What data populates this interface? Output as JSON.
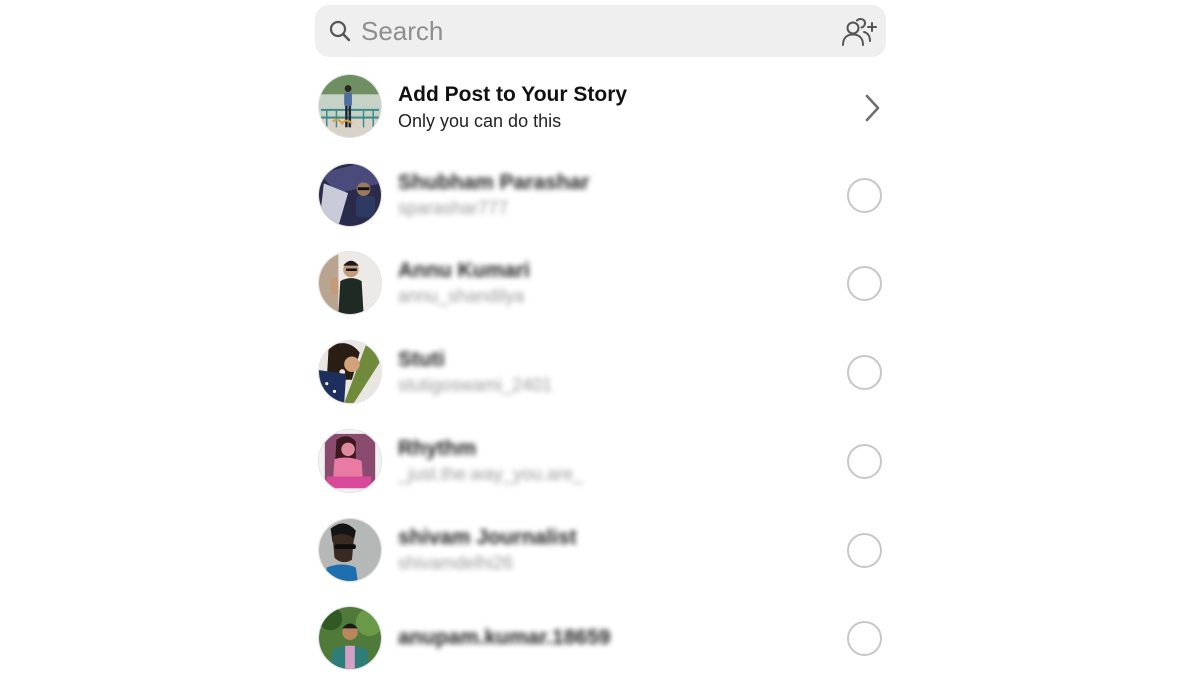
{
  "search": {
    "placeholder": "Search",
    "value": "",
    "search_icon": "magnifier-icon",
    "add_people_icon": "add-people-icon"
  },
  "story_row": {
    "title": "Add Post to Your Story",
    "subtitle": "Only you can do this",
    "trailing_icon": "chevron-right-icon"
  },
  "contacts": [
    {
      "name": "Shubham Parashar",
      "username": "sparashar777",
      "selected": false,
      "blurred": true
    },
    {
      "name": "Annu Kumari",
      "username": "annu_shandilya",
      "selected": false,
      "blurred": true
    },
    {
      "name": "Stuti",
      "username": "stutigoswami_2401",
      "selected": false,
      "blurred": true
    },
    {
      "name": "Rhythm",
      "username": "_just.the.way_you.are_",
      "selected": false,
      "blurred": true
    },
    {
      "name": "shivam Journalist",
      "username": "shivamdelhi26",
      "selected": false,
      "blurred": true
    },
    {
      "name": "anupam.kumar.18659",
      "username": "",
      "selected": false,
      "blurred": true
    }
  ],
  "colors": {
    "search_bg": "#efefef",
    "placeholder": "#8e8e8e",
    "radio_border": "#c7c7c7",
    "chevron": "#6f6f6f"
  }
}
